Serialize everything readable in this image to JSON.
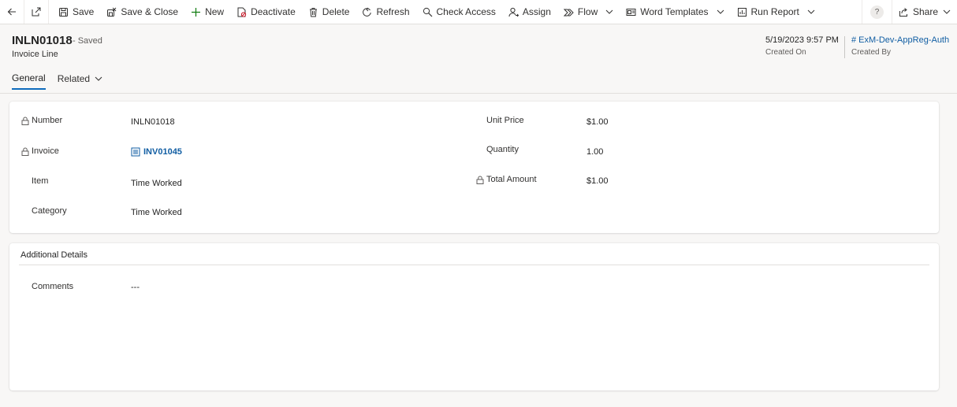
{
  "commandbar": {
    "items": [
      {
        "label": "Save",
        "icon": "save-icon"
      },
      {
        "label": "Save & Close",
        "icon": "save-close-icon"
      },
      {
        "label": "New",
        "icon": "plus-icon"
      },
      {
        "label": "Deactivate",
        "icon": "deactivate-icon"
      },
      {
        "label": "Delete",
        "icon": "trash-icon"
      },
      {
        "label": "Refresh",
        "icon": "refresh-icon"
      },
      {
        "label": "Check Access",
        "icon": "check-access-icon"
      },
      {
        "label": "Assign",
        "icon": "assign-icon"
      },
      {
        "label": "Flow",
        "icon": "flow-icon"
      },
      {
        "label": "Word Templates",
        "icon": "word-templates-icon"
      },
      {
        "label": "Run Report",
        "icon": "report-icon"
      }
    ],
    "help_label": "?",
    "share_label": "Share"
  },
  "header": {
    "title": "INLN01018",
    "status": "- Saved",
    "entity": "Invoice Line",
    "created_on_value": "5/19/2023 9:57 PM",
    "created_on_label": "Created On",
    "created_by_value": "# ExM-Dev-AppReg-Auth",
    "created_by_label": "Created By"
  },
  "tabs": [
    {
      "label": "General",
      "active": true
    },
    {
      "label": "Related",
      "active": false
    }
  ],
  "general": {
    "number_label": "Number",
    "number_value": "INLN01018",
    "invoice_label": "Invoice",
    "invoice_value": "INV01045",
    "item_label": "Item",
    "item_value": "Time Worked",
    "category_label": "Category",
    "category_value": "Time Worked",
    "unit_price_label": "Unit Price",
    "unit_price_value": "$1.00",
    "quantity_label": "Quantity",
    "quantity_value": "1.00",
    "total_amount_label": "Total Amount",
    "total_amount_value": "$1.00"
  },
  "additional": {
    "title": "Additional Details",
    "comments_label": "Comments",
    "comments_value": "---"
  },
  "colors": {
    "accent": "#0f6cbd",
    "link": "#115ea3",
    "background": "#f8f7f6"
  }
}
